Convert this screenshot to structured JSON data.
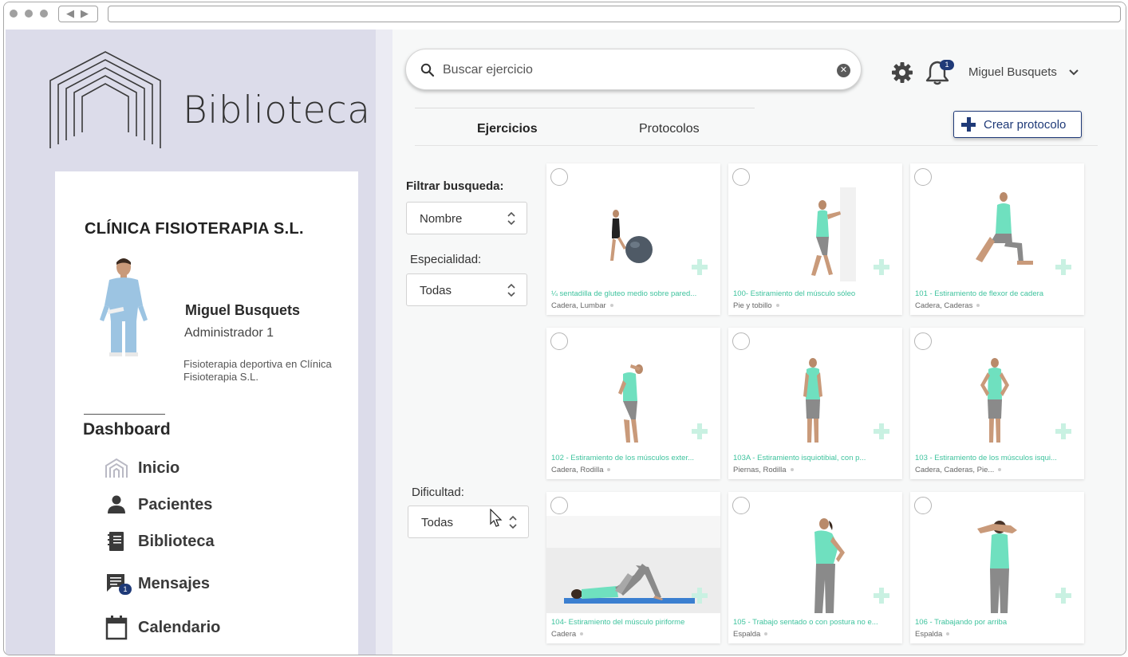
{
  "app": {
    "title": "Biblioteca"
  },
  "sidebar": {
    "clinic_name": "CLÍNICA FISIOTERAPIA S.L.",
    "user": {
      "name": "Miguel Busquets",
      "role": "Administrador 1",
      "description": "Fisioterapia deportiva en Clínica Fisioterapia S.L."
    },
    "section_title": "Dashboard",
    "menu": [
      {
        "label": "Inicio",
        "icon": "home-icon"
      },
      {
        "label": "Pacientes",
        "icon": "person-icon"
      },
      {
        "label": "Biblioteca",
        "icon": "book-icon"
      },
      {
        "label": "Mensajes",
        "icon": "message-icon",
        "badge": "1"
      },
      {
        "label": "Calendario",
        "icon": "calendar-icon"
      }
    ]
  },
  "header": {
    "search_placeholder": "Buscar ejercicio",
    "notifications_count": "1",
    "account_name": "Miguel Busquets"
  },
  "tabs": [
    {
      "label": "Ejercicios",
      "active": true
    },
    {
      "label": "Protocolos",
      "active": false
    }
  ],
  "create_button_label": "Crear protocolo",
  "filters": {
    "title": "Filtrar busqueda:",
    "sort_value": "Nombre",
    "specialty_label": "Especialidad:",
    "specialty_value": "Todas",
    "difficulty_label": "Dificultad:",
    "difficulty_value": "Todas"
  },
  "exercises": [
    {
      "title": "¼ sentadilla de gluteo medio sobre pared...",
      "tags": "Cadera, Lumbar"
    },
    {
      "title": "100- Estiramiento del músculo sóleo",
      "tags": "Pie y tobillo"
    },
    {
      "title": "101 - Estiramiento de flexor de cadera",
      "tags": "Cadera, Caderas"
    },
    {
      "title": "102 - Estiramiento de los músculos exter...",
      "tags": "Cadera, Rodilla"
    },
    {
      "title": "103A - Estiramiento isquiotibial, con p...",
      "tags": "Piernas, Rodilla"
    },
    {
      "title": "103 - Estiramiento de los músculos isqui...",
      "tags": "Cadera, Caderas, Pie..."
    },
    {
      "title": "104- Estiramiento del músculo piriforme",
      "tags": "Cadera"
    },
    {
      "title": "105 - Trabajo sentado o con postura no e...",
      "tags": "Espalda"
    },
    {
      "title": "106 - Trabajando por arriba",
      "tags": "Espalda"
    }
  ],
  "colors": {
    "sidebar_bg": "#dcdcea",
    "accent_navy": "#1f3a78",
    "exercise_title": "#3fc39e",
    "shirt_mint": "#6fe0bf"
  }
}
